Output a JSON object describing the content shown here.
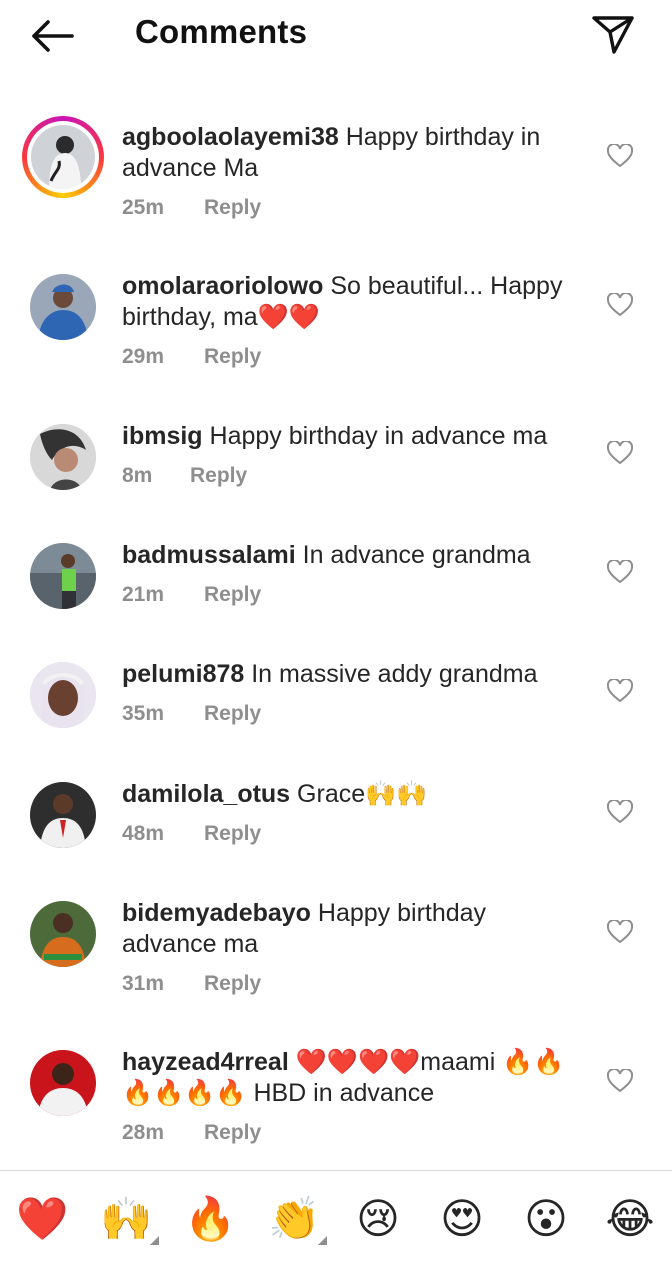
{
  "header": {
    "back_icon": "arrow-left-icon",
    "title": "Comments",
    "send_icon": "paper-plane-icon"
  },
  "comments": [
    {
      "username": "agboolaolayemi38",
      "text": "Happy birthday in advance Ma",
      "time": "25m",
      "reply": "Reply",
      "has_story_ring": true
    },
    {
      "username": "omolaraoriolowo",
      "text": "So beautiful... Happy birthday, ma❤️❤️",
      "time": "29m",
      "reply": "Reply"
    },
    {
      "username": "ibmsig",
      "text": "Happy birthday in advance ma",
      "time": "8m",
      "reply": "Reply"
    },
    {
      "username": "badmussalami",
      "text": "In advance grandma",
      "time": "21m",
      "reply": "Reply"
    },
    {
      "username": "pelumi878",
      "text": "In massive addy grandma",
      "time": "35m",
      "reply": "Reply"
    },
    {
      "username": "damilola_otus",
      "text": "Grace🙌🙌",
      "time": "48m",
      "reply": "Reply"
    },
    {
      "username": "bidemyadebayo",
      "text": "Happy birthday advance ma",
      "time": "31m",
      "reply": "Reply"
    },
    {
      "username": "hayzead4rreal",
      "text": "❤️❤️❤️❤️maami 🔥🔥🔥🔥🔥🔥 HBD in advance",
      "time": "28m",
      "reply": "Reply"
    }
  ],
  "emoji_bar": [
    "❤️",
    "🙌",
    "🔥",
    "👏",
    "😢",
    "😍",
    "😮",
    "😂"
  ],
  "colors": {
    "secondary_text": "#8e8e8e",
    "primary_text": "#262626",
    "divider": "#dbdbdb"
  }
}
